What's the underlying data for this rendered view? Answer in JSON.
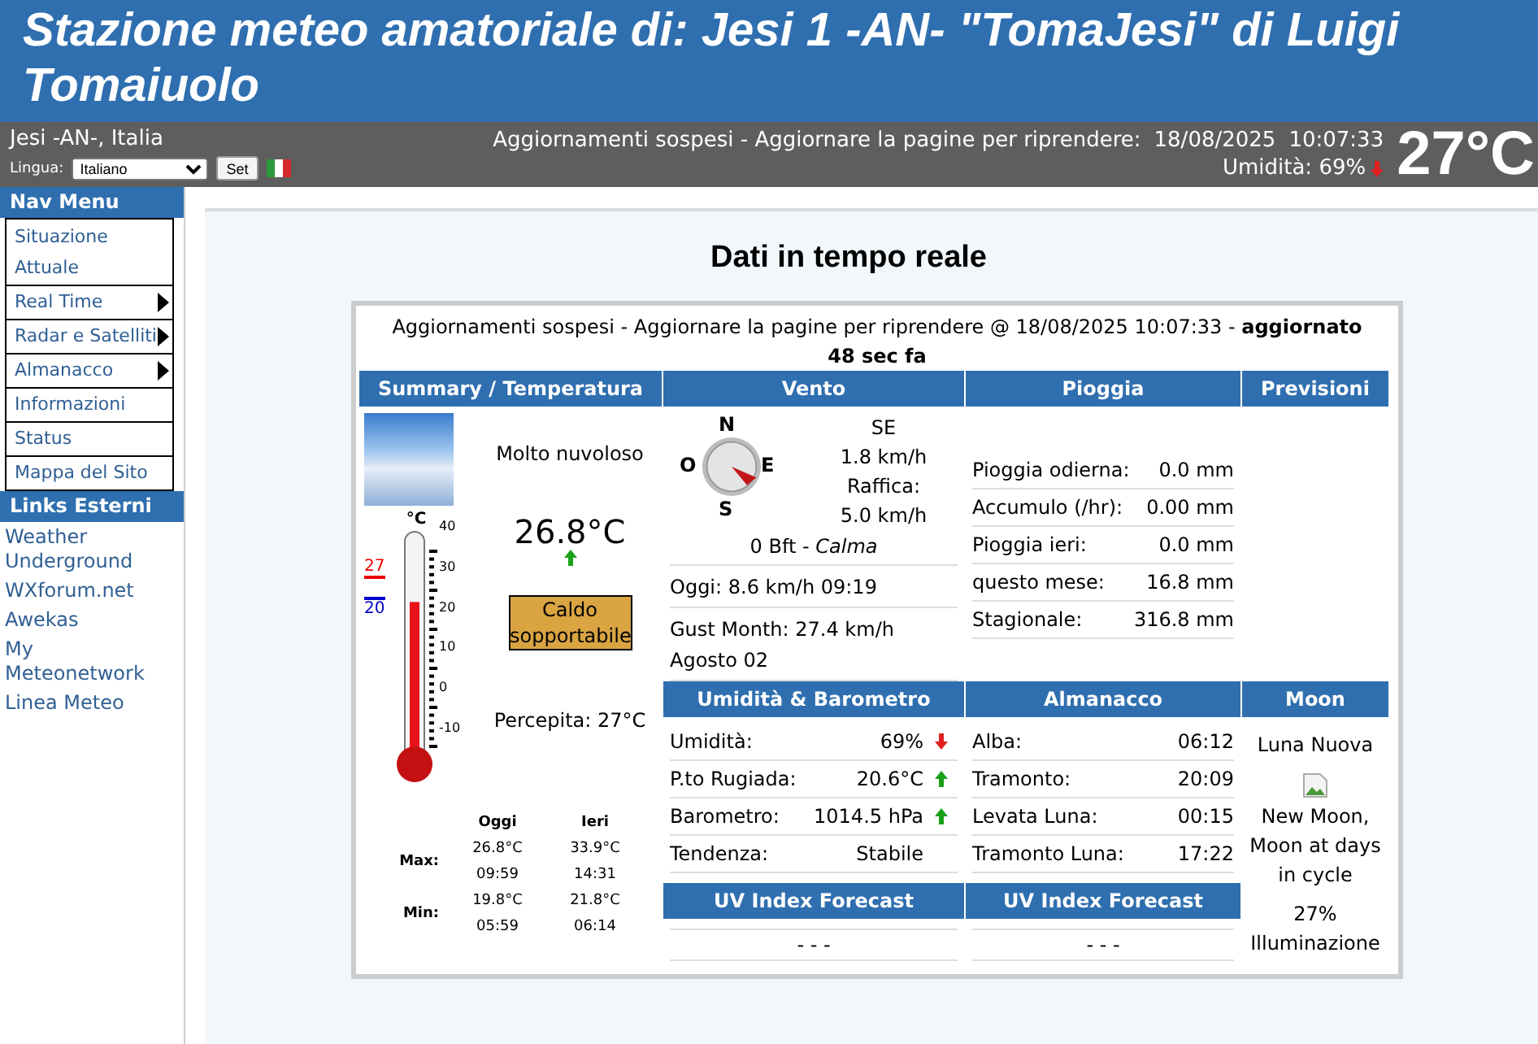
{
  "header": {
    "title": "Stazione meteo amatoriale di: Jesi 1 -AN- \"TomaJesi\" di Luigi Tomaiuolo"
  },
  "topbar": {
    "location": "Jesi -AN-, Italia",
    "language_label": "Lingua:",
    "language_value": "Italiano",
    "set_button": "Set",
    "status": "Aggiornamenti sospesi - Aggiornare la pagine per riprendere:",
    "date": "18/08/2025",
    "time": "10:07:33",
    "humidity": "Umidità: 69%",
    "humidity_rising": false,
    "temperature": "27°C"
  },
  "nav_menu": {
    "title": "Nav Menu",
    "items": [
      {
        "label": "Situazione Attuale",
        "submenu": false
      },
      {
        "label": "Real Time",
        "submenu": true
      },
      {
        "label": "Radar e Satelliti",
        "submenu": true
      },
      {
        "label": "Almanacco",
        "submenu": true
      },
      {
        "label": "Informazioni",
        "submenu": false
      },
      {
        "label": "Status",
        "submenu": false
      },
      {
        "label": "Mappa del Sito",
        "submenu": false
      }
    ],
    "links_title": "Links Esterni",
    "links": [
      "Weather Underground",
      "WXforum.net",
      "Awekas",
      "My Meteonetwork",
      "Linea Meteo"
    ]
  },
  "main": {
    "title": "Dati in tempo reale",
    "notice": "Aggiornamenti sospesi - Aggiornare la pagine per riprendere @ 18/08/2025 10:07:33 - **aggiornato 48 sec fa**"
  },
  "summary": {
    "header": "Summary / Temperatura",
    "condition": "Molto nuvoloso",
    "temperature": "26.8°C",
    "rising": true,
    "comfort": "Caldo sopportabile",
    "feels_like": "Percepita: 27°C",
    "thermometer": {
      "unit": "°C",
      "level": 0.74,
      "max_mark": "27",
      "min_mark": "20",
      "ticks": [
        "40",
        "30",
        "20",
        "10",
        "0",
        "-10"
      ]
    },
    "stats": {
      "columns": [
        "Oggi",
        "Ieri"
      ],
      "rows": [
        {
          "label": "Max:",
          "values": [
            [
              "26.8°C",
              "09:59"
            ],
            [
              "33.9°C",
              "14:31"
            ]
          ]
        },
        {
          "label": "Min:",
          "values": [
            [
              "19.8°C",
              "05:59"
            ],
            [
              "21.8°C",
              "06:14"
            ]
          ]
        }
      ]
    }
  },
  "wind": {
    "header": "Vento",
    "compass": {
      "n": "N",
      "w": "O",
      "e": "E",
      "s": "S"
    },
    "direction": "SE",
    "speed": "1.8 km/h",
    "gust_label": "Raffica:",
    "gust": "5.0 km/h",
    "beaufort": "0 Bft - *Calma*",
    "rows": [
      "Oggi: 8.6 km/h 09:19",
      "Gust Month: 27.4 km/h Agosto 02"
    ]
  },
  "rain": {
    "header": "Pioggia",
    "rows": [
      {
        "label": "Pioggia odierna:",
        "value": "0.0 mm"
      },
      {
        "label": "Accumulo (/hr):",
        "value": "0.00 mm"
      },
      {
        "label": "Pioggia ieri:",
        "value": "0.0 mm"
      },
      {
        "label": "questo mese:",
        "value": "16.8 mm"
      },
      {
        "label": "Stagionale:",
        "value": "316.8 mm"
      }
    ]
  },
  "forecast": {
    "header": "Previsioni"
  },
  "humidity": {
    "header": "Umidità & Barometro",
    "rows": [
      {
        "label": "Umidità:",
        "value": "69%",
        "rising": false
      },
      {
        "label": "P.to Rugiada:",
        "value": "20.6°C",
        "rising": true
      },
      {
        "label": "Barometro:",
        "value": "1014.5 hPa",
        "rising": true
      },
      {
        "label": "Tendenza:",
        "value": "Stabile"
      }
    ]
  },
  "almanac": {
    "header": "Almanacco",
    "rows": [
      {
        "label": "Alba:",
        "value": "06:12"
      },
      {
        "label": "Tramonto:",
        "value": "20:09"
      },
      {
        "label": "Levata Luna:",
        "value": "00:15"
      },
      {
        "label": "Tramonto Luna:",
        "value": "17:22"
      }
    ]
  },
  "moon": {
    "header": "Moon",
    "phase": "Luna Nuova",
    "image_alt": "New Moon, Moon at days in cycle",
    "illumination": "27%",
    "illumination_label": "Illuminazione"
  },
  "uv": [
    {
      "header": "UV Index Forecast",
      "value": "- - -"
    },
    {
      "header": "UV Index Forecast",
      "value": "- - -"
    }
  ]
}
